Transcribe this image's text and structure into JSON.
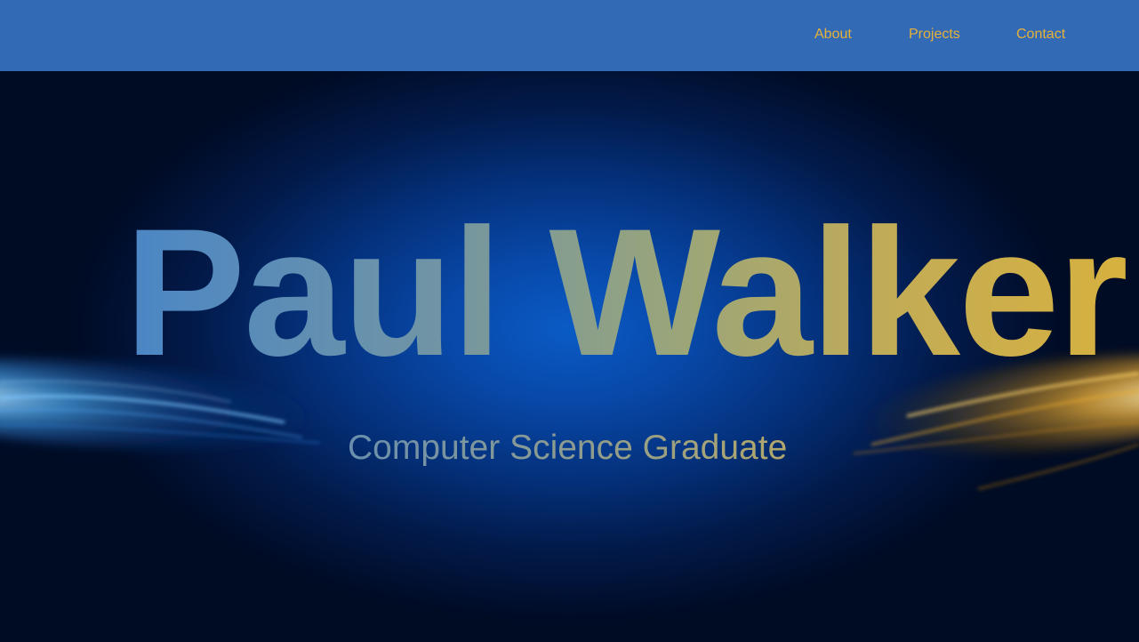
{
  "nav": {
    "items": [
      {
        "label": "About"
      },
      {
        "label": "Projects"
      },
      {
        "label": "Contact"
      }
    ]
  },
  "hero": {
    "name": "Paul Walker",
    "subtitle": "Computer Science Graduate"
  },
  "colors": {
    "navbar_bg": "#336ab5",
    "nav_link": "#e5b13a",
    "hero_glow": "#0a5bc6",
    "name_gradient_start": "#4a86c6",
    "name_gradient_end": "#d7b13f"
  }
}
